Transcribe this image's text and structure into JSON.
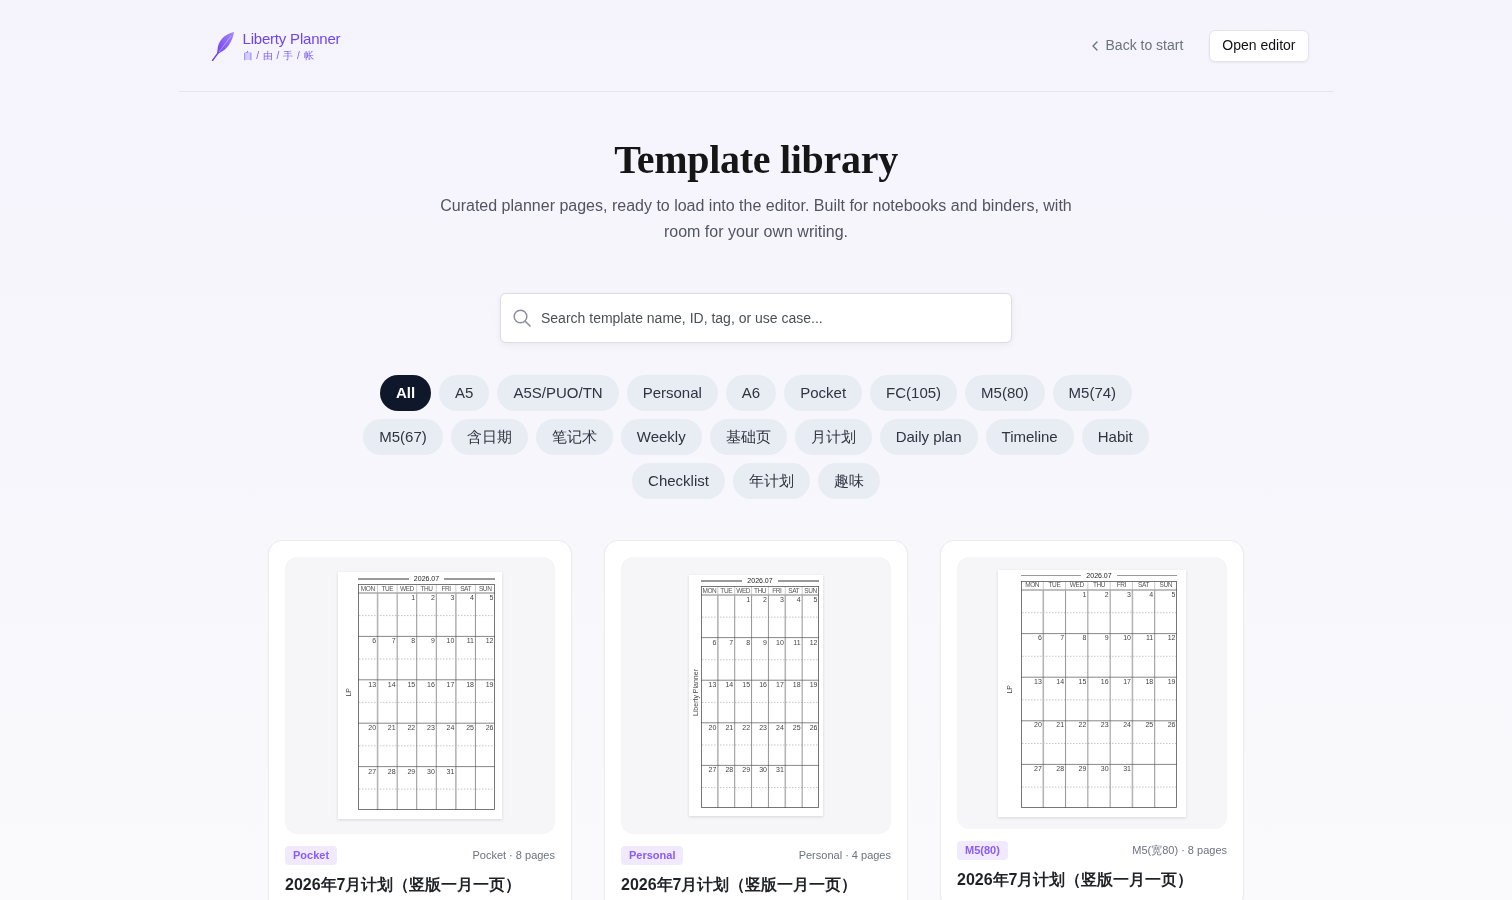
{
  "header": {
    "brand": {
      "name": "Liberty Planner",
      "tagline": "自 / 由 / 手 / 帐"
    },
    "back_link": "Back to start",
    "open_button": "Open editor"
  },
  "hero": {
    "title": "Template library",
    "subtitle": "Curated planner pages, ready to load into the editor. Built for notebooks and binders, with room for your own writing."
  },
  "search": {
    "placeholder": "Search template name, ID, tag, or use case..."
  },
  "filters": [
    {
      "label": "All",
      "selected": true
    },
    {
      "label": "A5",
      "selected": false
    },
    {
      "label": "A5S/PUO/TN",
      "selected": false
    },
    {
      "label": "Personal",
      "selected": false
    },
    {
      "label": "A6",
      "selected": false
    },
    {
      "label": "Pocket",
      "selected": false
    },
    {
      "label": "FC(105)",
      "selected": false
    },
    {
      "label": "M5(80)",
      "selected": false
    },
    {
      "label": "M5(74)",
      "selected": false
    },
    {
      "label": "M5(67)",
      "selected": false
    },
    {
      "label": "含日期",
      "selected": false
    },
    {
      "label": "笔记术",
      "selected": false
    },
    {
      "label": "Weekly",
      "selected": false
    },
    {
      "label": "基础页",
      "selected": false
    },
    {
      "label": "月计划",
      "selected": false
    },
    {
      "label": "Daily plan",
      "selected": false
    },
    {
      "label": "Timeline",
      "selected": false
    },
    {
      "label": "Habit",
      "selected": false
    },
    {
      "label": "Checklist",
      "selected": false
    },
    {
      "label": "年计划",
      "selected": false
    },
    {
      "label": "趣味",
      "selected": false
    }
  ],
  "templates": [
    {
      "preview": {
        "kind": "pocket",
        "side_label": "LP",
        "heading": "2026.07",
        "weekdays": [
          "MON",
          "TUE",
          "WED",
          "THU",
          "FRI",
          "SAT",
          "SUN"
        ],
        "weeks": [
          {
            "kind": "first",
            "days": [
              "1",
              "2",
              "3",
              "4",
              "5"
            ]
          },
          {
            "kind": "full",
            "days": [
              "6",
              "7",
              "8",
              "9",
              "10",
              "11",
              "12"
            ]
          },
          {
            "kind": "full",
            "days": [
              "13",
              "14",
              "15",
              "16",
              "17",
              "18",
              "19"
            ]
          },
          {
            "kind": "full",
            "days": [
              "20",
              "21",
              "22",
              "23",
              "24",
              "25",
              "26"
            ]
          },
          {
            "kind": "last",
            "days": [
              "27",
              "28",
              "29",
              "30",
              "31"
            ]
          }
        ]
      },
      "tag": "Pocket",
      "meta": "Pocket · 8 pages",
      "title": "2026年7月计划（竖版一月一页）"
    },
    {
      "preview": {
        "kind": "personal",
        "side_label": "Liberty Planner",
        "heading": "2026.07",
        "weekdays": [
          "MON",
          "TUE",
          "WED",
          "THU",
          "FRI",
          "SAT",
          "SUN"
        ],
        "weeks": [
          {
            "kind": "first",
            "days": [
              "1",
              "2",
              "3",
              "4",
              "5"
            ]
          },
          {
            "kind": "full",
            "days": [
              "6",
              "7",
              "8",
              "9",
              "10",
              "11",
              "12"
            ]
          },
          {
            "kind": "full",
            "days": [
              "13",
              "14",
              "15",
              "16",
              "17",
              "18",
              "19"
            ]
          },
          {
            "kind": "full",
            "days": [
              "20",
              "21",
              "22",
              "23",
              "24",
              "25",
              "26"
            ]
          },
          {
            "kind": "last",
            "days": [
              "27",
              "28",
              "29",
              "30",
              "31"
            ]
          }
        ]
      },
      "tag": "Personal",
      "meta": "Personal · 4 pages",
      "title": "2026年7月计划（竖版一月一页）"
    },
    {
      "preview": {
        "kind": "m5",
        "side_label": "LP",
        "heading": "2026.07",
        "weekdays": [
          "MON",
          "TUE",
          "WED",
          "THU",
          "FRI",
          "SAT",
          "SUN"
        ],
        "weeks": [
          {
            "kind": "first",
            "days": [
              "1",
              "2",
              "3",
              "4",
              "5"
            ]
          },
          {
            "kind": "full",
            "days": [
              "6",
              "7",
              "8",
              "9",
              "10",
              "11",
              "12"
            ]
          },
          {
            "kind": "full",
            "days": [
              "13",
              "14",
              "15",
              "16",
              "17",
              "18",
              "19"
            ]
          },
          {
            "kind": "full",
            "days": [
              "20",
              "21",
              "22",
              "23",
              "24",
              "25",
              "26"
            ]
          },
          {
            "kind": "last",
            "days": [
              "27",
              "28",
              "29",
              "30",
              "31"
            ]
          }
        ]
      },
      "tag": "M5(80)",
      "meta": "M5(宽80) · 8 pages",
      "title": "2026年7月计划（竖版一月一页）"
    }
  ]
}
